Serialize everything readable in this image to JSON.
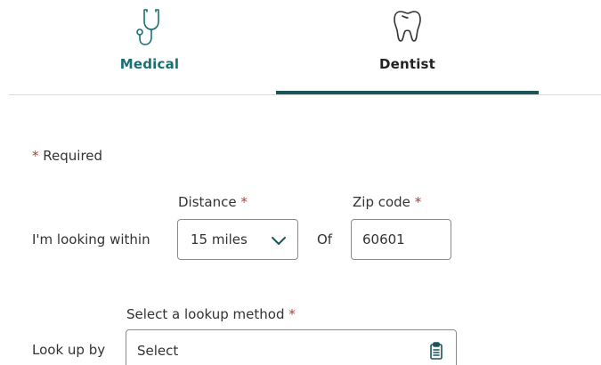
{
  "tabs": [
    {
      "label": "Medical",
      "icon": "stethoscope-icon",
      "color": "#1a6f73"
    },
    {
      "label": "Dentist",
      "icon": "tooth-icon",
      "color": "#222222",
      "selected": true
    }
  ],
  "form": {
    "required_asterisk": "*",
    "required_text": " Required",
    "distance": {
      "label": "Distance",
      "value": "15 miles"
    },
    "zip": {
      "label": "Zip code",
      "value": "60601"
    },
    "looking_within_label": "I'm looking within",
    "of_label": "Of",
    "lookup_method": {
      "label": "Select a lookup method",
      "value": "Select",
      "icon": "clipboard-icon"
    },
    "look_up_by_label": "Look up by"
  },
  "colors": {
    "accent": "#1b5559",
    "required": "#c0392b"
  }
}
